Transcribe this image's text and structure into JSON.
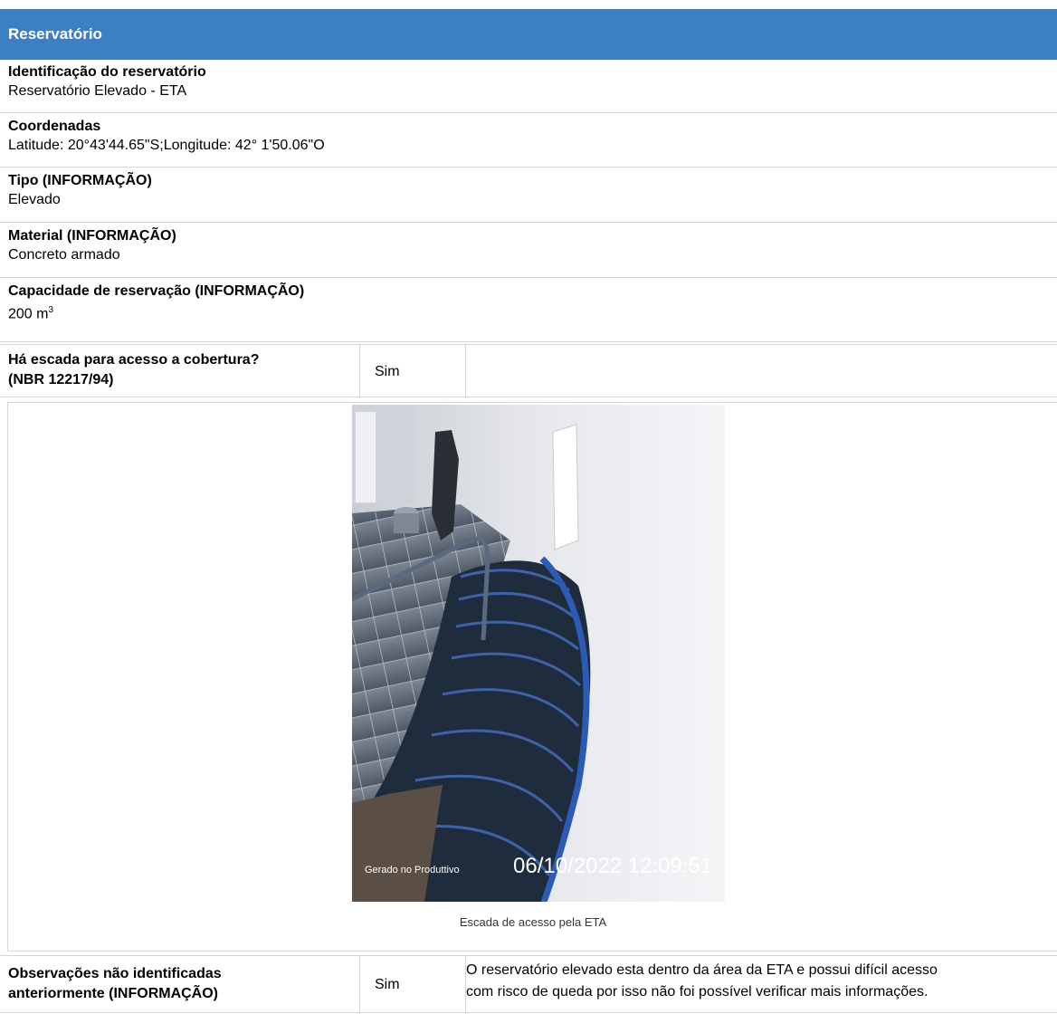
{
  "header": {
    "title": "Reservatório"
  },
  "fields": [
    {
      "label": "Identificação do reservatório",
      "value": "Reservatório Elevado - ETA"
    },
    {
      "label": "Coordenadas",
      "value": "Latitude: 20°43'44.65\"S;Longitude: 42° 1'50.06\"O"
    },
    {
      "label": "Tipo (INFORMAÇÃO)",
      "value": "Elevado"
    },
    {
      "label": "Material (INFORMAÇÃO)",
      "value": "Concreto armado"
    },
    {
      "label": "Capacidade de reservação (INFORMAÇÃO)",
      "value": "200 m",
      "unit_sup": "3"
    }
  ],
  "rows": [
    {
      "label_line1": "Há escada para acesso a cobertura?",
      "label_line2": "(NBR 12217/94)",
      "answer": "Sim",
      "note_line1": "",
      "note_line2": ""
    },
    {
      "label_line1": "Observações não identificadas",
      "label_line2": "anteriormente (INFORMAÇÃO)",
      "answer": "Sim",
      "note_line1": "O reservatório elevado esta dentro da área da ETA e possui difícil acesso",
      "note_line2": "com risco de queda por isso não foi possível verificar mais informações."
    }
  ],
  "photo": {
    "stamp_small": "Gerado no Produttivo",
    "stamp_datetime": "06/10/2022 12:09:51",
    "caption": "Escada de acesso pela ETA"
  }
}
